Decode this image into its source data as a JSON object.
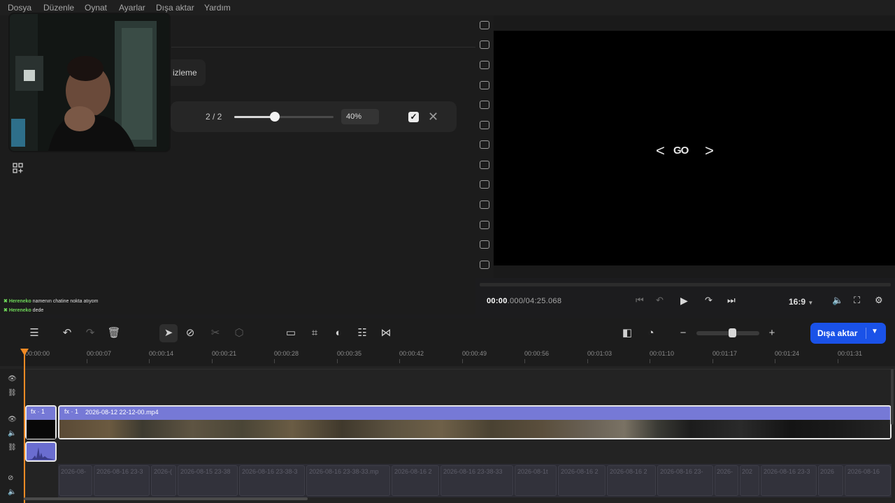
{
  "menu": {
    "items": [
      "Dosya",
      "Düzenle",
      "Oynat",
      "Ayarlar",
      "Dışa aktar",
      "Yardım"
    ]
  },
  "left_panel": {
    "preview_label": "izleme",
    "search": {
      "match_count": "2 / 2",
      "zoom_percent": "40%",
      "slider_value_fraction": 0.41
    }
  },
  "chat": {
    "messages": [
      {
        "user": "Hereneko",
        "text": "namenın chatine nokta atıyom"
      },
      {
        "user": "Hereneko",
        "text": "dede"
      }
    ]
  },
  "player": {
    "logo_text": "GO",
    "timecode_current": "00:00",
    "timecode_rest": ".000/04:25.068",
    "aspect_ratio": "16:9"
  },
  "toolbar": {
    "export_label": "Dışa aktar"
  },
  "ruler": {
    "ticks": [
      "00:00:00",
      "00:00:07",
      "00:00:14",
      "00:00:21",
      "00:00:28",
      "00:00:35",
      "00:00:42",
      "00:00:49",
      "00:00:56",
      "00:01:03",
      "00:01:10",
      "00:01:17",
      "00:01:24",
      "00:01:31"
    ]
  },
  "timeline": {
    "clip_small_label": "fx · 1",
    "clip_main_fx": "fx · 1",
    "clip_main_name": "2026-08-12 22-12-00.mp4",
    "lower_clips": [
      "2026-08-",
      "2026-08-16 23-3",
      "2026-(",
      "2026-08-15 23-38",
      "2026-08-16 23-38-3",
      "2026-08-16 23-38-33.mp",
      "2026-08-16 2",
      "2026-08-16 23-38-33",
      "2026-08-1t",
      "2026-08-16 2",
      "2026-08-16 2",
      "2026-08-16 23-",
      "2026-",
      "202",
      "2026-08-16 23-3",
      "2026",
      "2026-08-16"
    ]
  },
  "colors": {
    "accent": "#1a52e8",
    "playhead": "#f08a24",
    "clip": "#7679d6",
    "chat_user": "#6fd85a"
  }
}
